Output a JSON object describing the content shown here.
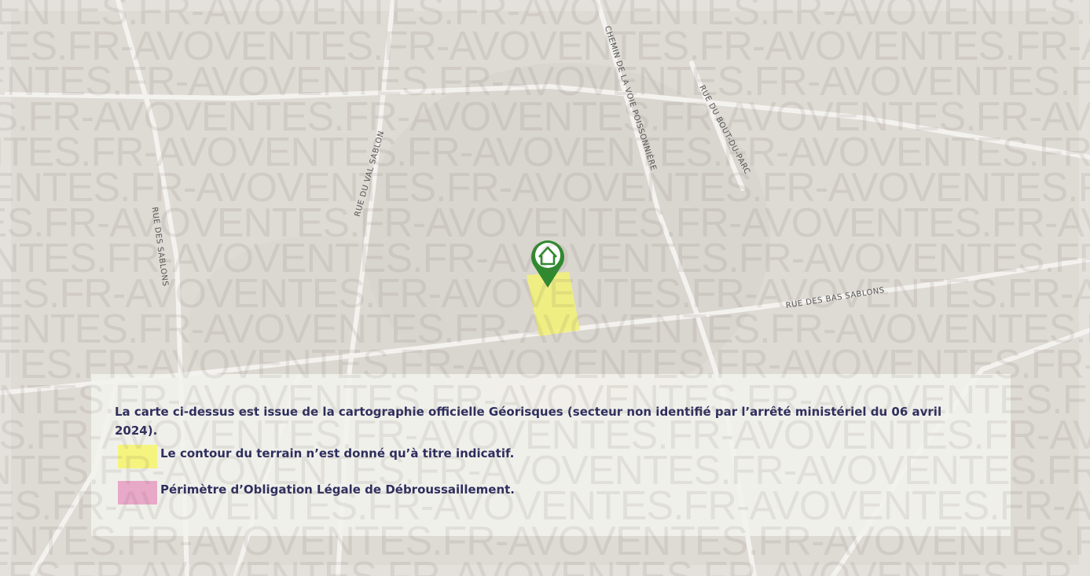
{
  "map": {
    "watermark_text": "VENTES.FR-AVOVENTES.FR-AVOVENTES.FR-AVOVENTES.FR-AVO",
    "streets": [
      {
        "id": "rue-des-sablons",
        "label": "RUE DES SABLONS"
      },
      {
        "id": "rue-du-val-sablon",
        "label": "RUE DU VAL SABLON"
      },
      {
        "id": "chemin",
        "label": "CHEMIN DE LA VOIE POISSONNIÈRE"
      },
      {
        "id": "bout-du-parc",
        "label": "RUE DU BOUT-DU-PARC"
      },
      {
        "id": "bas-sablons",
        "label": "RUE DES BAS SABLONS"
      }
    ],
    "marker_icon": "home-icon",
    "colors": {
      "background": "#e4e1dc",
      "parcel": "#f1f07c",
      "marker": "#2f8a2f",
      "old_zone": "#e8a8c8",
      "text": "#2e2e5e"
    }
  },
  "legend": {
    "note": "La carte ci-dessus est issue de la cartographie officielle Géorisques (secteur non identifié par l’arrêté ministériel du 06 avril 2024).",
    "items": [
      {
        "label": "Le contour du terrain n’est donné qu’à titre indicatif.",
        "color": "#f5f47e"
      },
      {
        "label": "Périmètre d’Obligation Légale de Débroussaillement.",
        "color": "#e8a8c8"
      }
    ]
  }
}
